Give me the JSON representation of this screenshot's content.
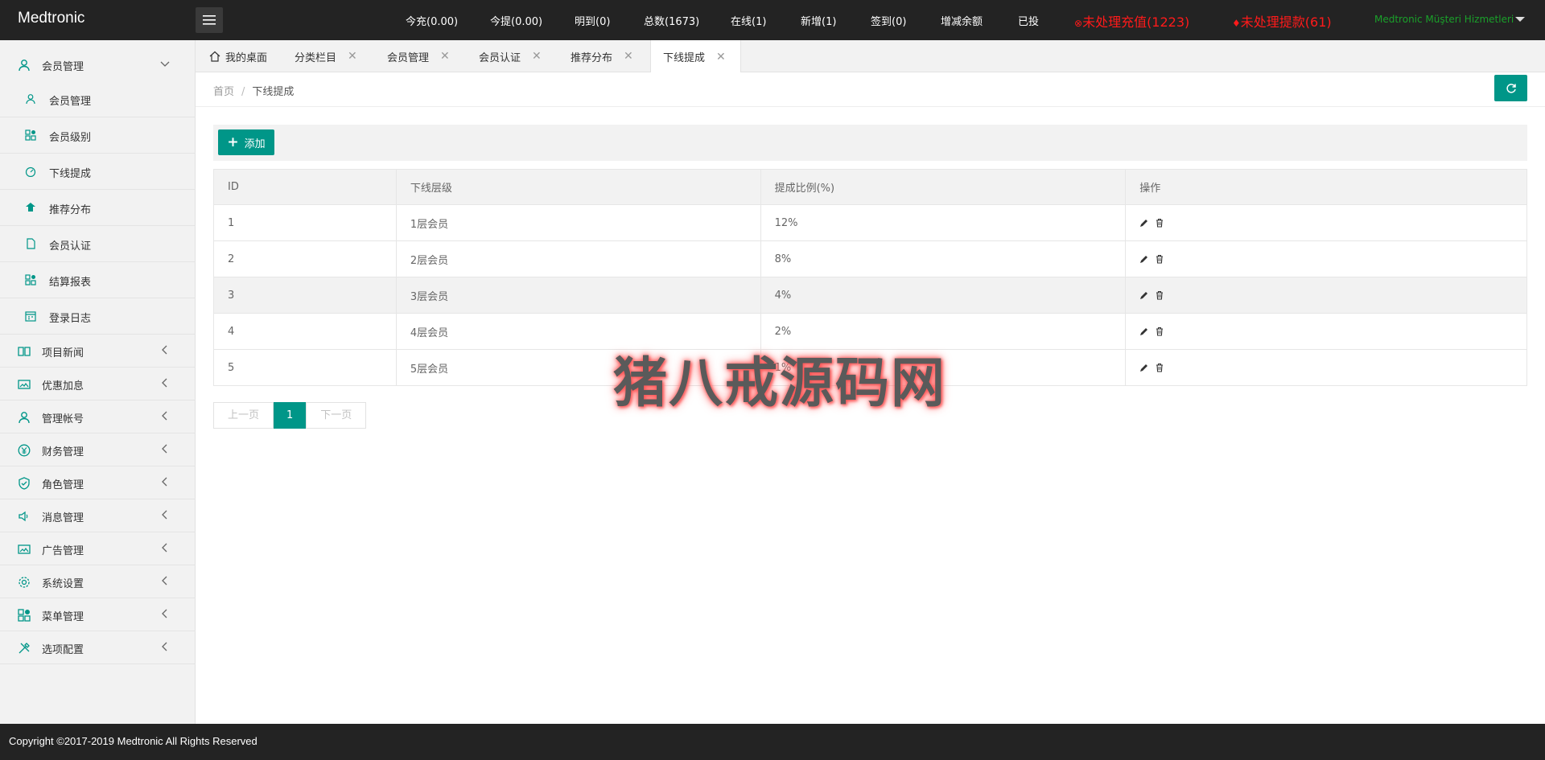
{
  "header": {
    "logo": "Medtronic",
    "stats": [
      {
        "label": "今充(0.00)"
      },
      {
        "label": "今提(0.00)"
      },
      {
        "label": "明到(0)"
      },
      {
        "label": "总数(1673)"
      },
      {
        "label": "在线(1)"
      },
      {
        "label": "新增(1)"
      },
      {
        "label": "签到(0)"
      },
      {
        "label": "增减余额"
      },
      {
        "label": "已投"
      }
    ],
    "alert_recharge": "未处理充值(1223)",
    "alert_withdraw": "未处理提款(61)",
    "user_menu": "Medtronic Müşteri Hizmetleri"
  },
  "sidebar": {
    "member_group": "会员管理",
    "sub_items": [
      "会员管理",
      "会员级别",
      "下线提成",
      "推荐分布",
      "会员认证",
      "结算报表",
      "登录日志"
    ],
    "groups": [
      "项目新闻",
      "优惠加息",
      "管理帐号",
      "财务管理",
      "角色管理",
      "消息管理",
      "广告管理",
      "系统设置",
      "菜单管理",
      "选项配置"
    ]
  },
  "tabs": {
    "home": "我的桌面",
    "items": [
      "分类栏目",
      "会员管理",
      "会员认证",
      "推荐分布",
      "下线提成"
    ]
  },
  "breadcrumb": {
    "home": "首页",
    "sep": "/",
    "current": "下线提成"
  },
  "toolbar": {
    "add_label": "添加"
  },
  "table": {
    "headers": [
      "ID",
      "下线层级",
      "提成比例(%)",
      "操作"
    ],
    "rows": [
      {
        "id": "1",
        "level": "1层会员",
        "ratio": "12%"
      },
      {
        "id": "2",
        "level": "2层会员",
        "ratio": "8%"
      },
      {
        "id": "3",
        "level": "3层会员",
        "ratio": "4%"
      },
      {
        "id": "4",
        "level": "4层会员",
        "ratio": "2%"
      },
      {
        "id": "5",
        "level": "5层会员",
        "ratio": "1%"
      }
    ]
  },
  "pager": {
    "prev": "上一页",
    "current": "1",
    "next": "下一页"
  },
  "watermark": "猪八戒源码网",
  "footer": {
    "copyright": "Copyright ©2017-2019 Medtronic All Rights Reserved"
  },
  "colors": {
    "accent": "#009688",
    "alert": "#ff1a1a",
    "header_bg": "#232323"
  }
}
